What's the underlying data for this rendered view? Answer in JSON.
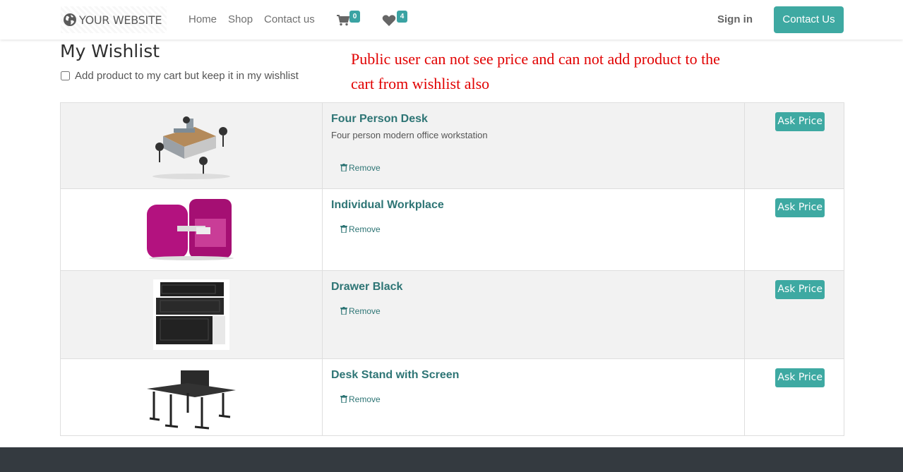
{
  "header": {
    "logo_text": "YOUR WEBSITE",
    "nav": [
      {
        "label": "Home"
      },
      {
        "label": "Shop"
      },
      {
        "label": "Contact us"
      }
    ],
    "cart_count": "0",
    "wishlist_count": "4",
    "sign_in": "Sign in",
    "contact_button": "Contact Us"
  },
  "page": {
    "title": "My Wishlist",
    "keep_checkbox_label": "Add product to my cart but keep it in my wishlist",
    "keep_checked": false,
    "annotation": "Public user can not see price and can not add product  to the cart from wishlist also"
  },
  "wishlist": [
    {
      "name": "Four Person Desk",
      "description": "Four person modern office workstation",
      "remove_label": "Remove",
      "action_label": "Ask Price",
      "image": "four-person-desk-image"
    },
    {
      "name": "Individual Workplace",
      "description": "",
      "remove_label": "Remove",
      "action_label": "Ask Price",
      "image": "individual-workplace-image"
    },
    {
      "name": "Drawer Black",
      "description": "",
      "remove_label": "Remove",
      "action_label": "Ask Price",
      "image": "drawer-black-image"
    },
    {
      "name": "Desk Stand with Screen",
      "description": "",
      "remove_label": "Remove",
      "action_label": "Ask Price",
      "image": "desk-stand-screen-image"
    }
  ],
  "colors": {
    "accent": "#3ea9a2",
    "product_link": "#2e7575",
    "annotation": "#e10000",
    "footer": "#343a40"
  }
}
